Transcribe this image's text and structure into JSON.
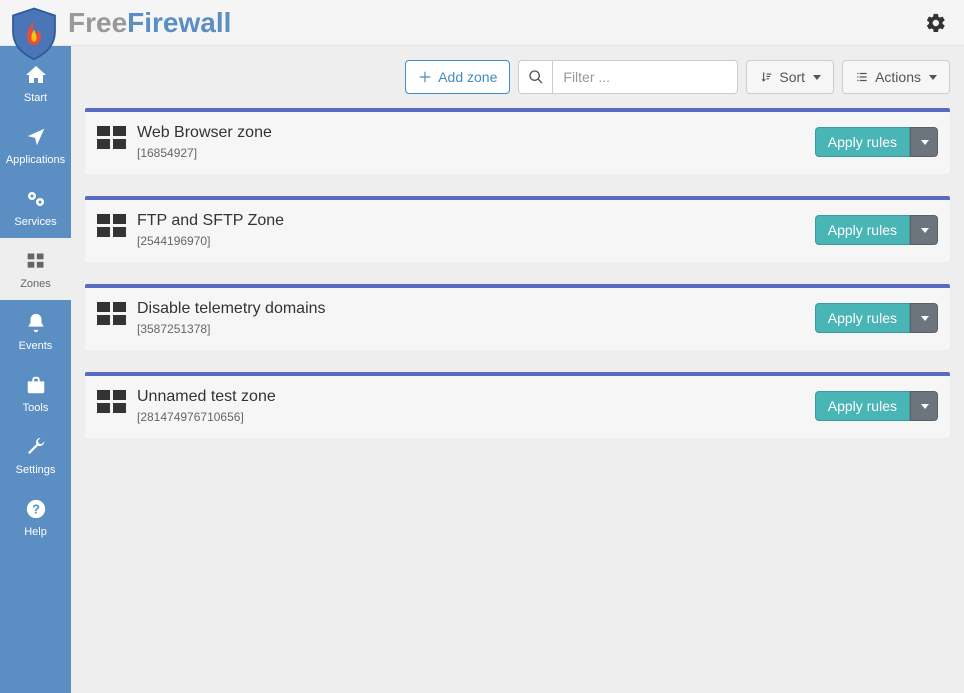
{
  "brand": {
    "part1": "Free",
    "part2": "Firewall"
  },
  "toolbar": {
    "add_zone": "Add zone",
    "filter_placeholder": "Filter ...",
    "sort": "Sort",
    "actions": "Actions"
  },
  "sidebar": {
    "items": [
      {
        "key": "start",
        "label": "Start"
      },
      {
        "key": "applications",
        "label": "Applications"
      },
      {
        "key": "services",
        "label": "Services"
      },
      {
        "key": "zones",
        "label": "Zones"
      },
      {
        "key": "events",
        "label": "Events"
      },
      {
        "key": "tools",
        "label": "Tools"
      },
      {
        "key": "settings",
        "label": "Settings"
      },
      {
        "key": "help",
        "label": "Help"
      }
    ]
  },
  "zones": [
    {
      "title": "Web Browser zone",
      "id": "[16854927]",
      "apply_label": "Apply rules"
    },
    {
      "title": "FTP and SFTP Zone",
      "id": "[2544196970]",
      "apply_label": "Apply rules"
    },
    {
      "title": "Disable telemetry domains",
      "id": "[3587251378]",
      "apply_label": "Apply rules"
    },
    {
      "title": "Unnamed test zone",
      "id": "[281474976710656]",
      "apply_label": "Apply rules"
    }
  ],
  "colors": {
    "sidebar": "#5b8ec3",
    "card_border": "#5b6bc0",
    "teal": "#4AB5B6",
    "gray_btn": "#6c757d"
  }
}
